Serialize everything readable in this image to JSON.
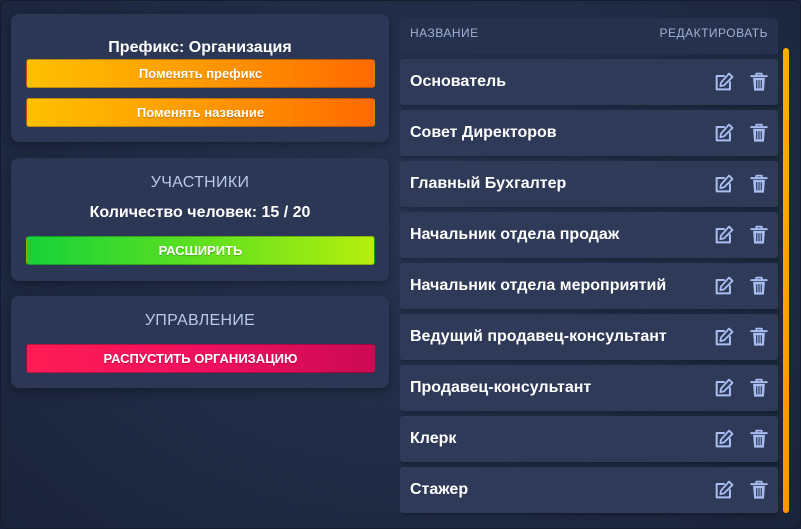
{
  "prefix_panel": {
    "title": "Префикс: Организация",
    "change_prefix_label": "Поменять префикс",
    "change_name_label": "Поменять название"
  },
  "members_panel": {
    "title": "УЧАСТНИКИ",
    "count_text": "Количество человек: 15 / 20",
    "expand_label": "РАСШИРИТЬ"
  },
  "manage_panel": {
    "title": "УПРАВЛЕНИЕ",
    "disband_label": "РАСПУСТИТЬ ОРГАНИЗАЦИЮ"
  },
  "roles": {
    "header_name": "НАЗВАНИЕ",
    "header_edit": "РЕДАКТИРОВАТЬ",
    "items": [
      {
        "name": "Основатель"
      },
      {
        "name": "Совет Директоров"
      },
      {
        "name": "Главный Бухгалтер"
      },
      {
        "name": "Начальник отдела продаж"
      },
      {
        "name": "Начальник отдела мероприятий"
      },
      {
        "name": "Ведущий продавец-консультант"
      },
      {
        "name": "Продавец-консультант"
      },
      {
        "name": "Клерк"
      },
      {
        "name": "Стажер"
      }
    ]
  },
  "icons": {
    "edit": "edit-icon",
    "delete": "trash-icon"
  },
  "colors": {
    "orange_button": "#ff8a00",
    "green_button": "#5fe020",
    "red_button": "#f0105e",
    "icon_color": "#a9bdf0",
    "scroll_thumb": "#ffa500"
  }
}
